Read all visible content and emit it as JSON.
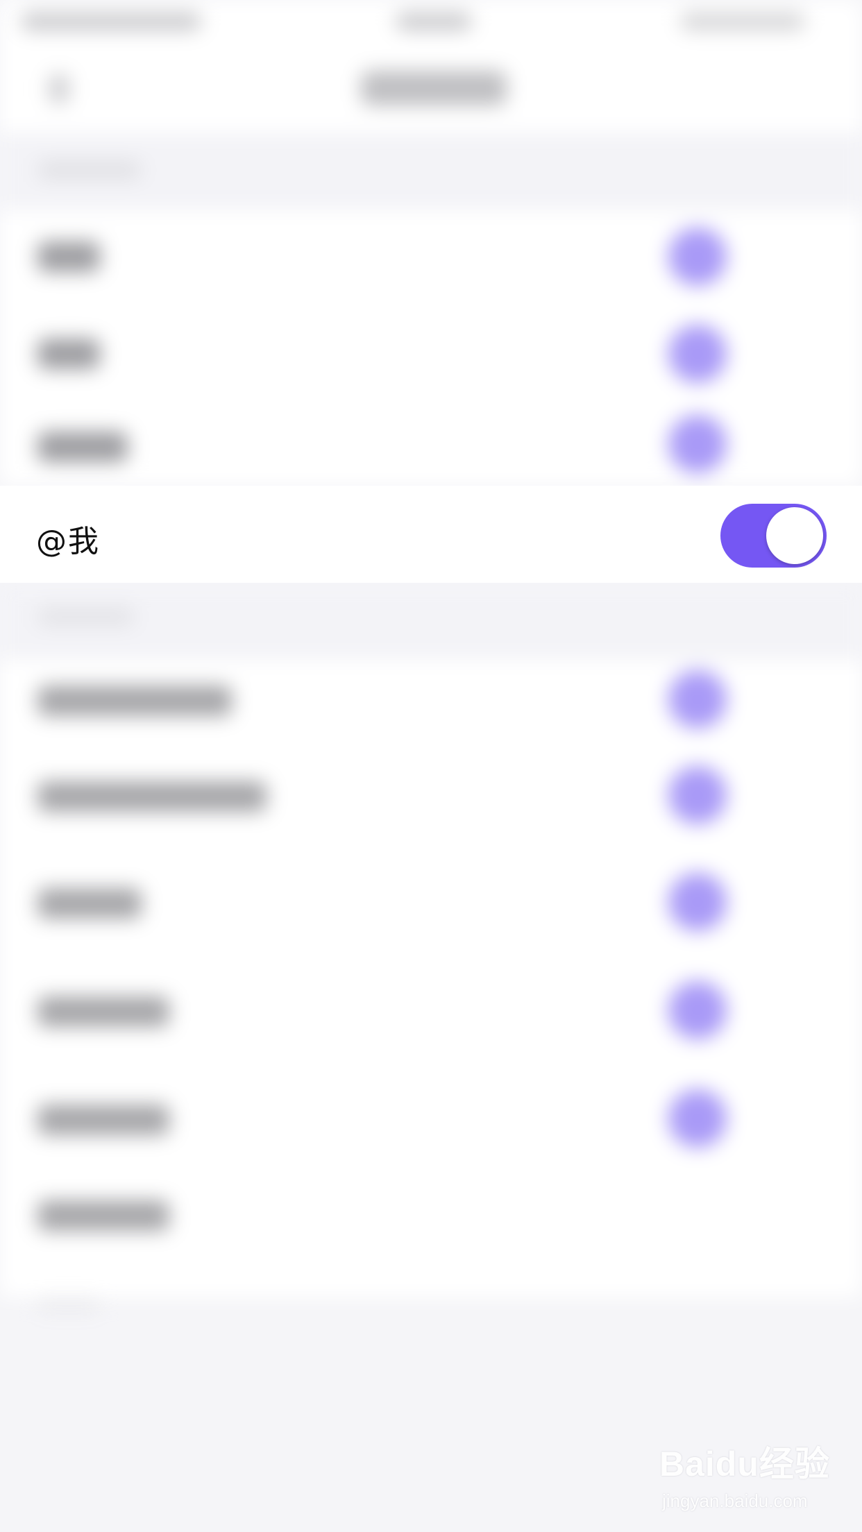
{
  "focused_row": {
    "label": "@我",
    "toggle_on": true
  },
  "colors": {
    "accent": "#7557f3",
    "toggle_knob": "#ffffff",
    "background": "#f5f5f8"
  },
  "watermark": {
    "brand": "Baidu经验",
    "url": "jingyan.baidu.com"
  }
}
